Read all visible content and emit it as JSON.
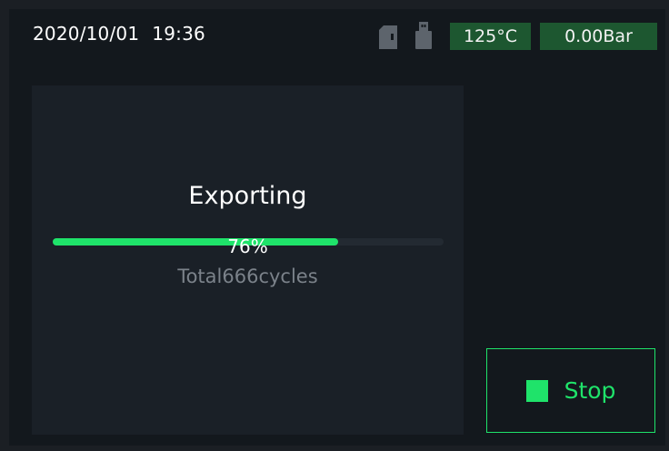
{
  "status_bar": {
    "date": "2020/10/01",
    "time": "19:36",
    "icons": [
      "sd-card-icon",
      "usb-drive-icon"
    ],
    "temperature": "125°C",
    "pressure": "0.00Bar"
  },
  "export": {
    "title": "Exporting",
    "progress_percent_label": "76%",
    "progress_fraction": 0.73,
    "cycles_text": "Total666cycles"
  },
  "actions": {
    "stop_label": "Stop"
  },
  "colors": {
    "background": "#13181d",
    "panel": "#1a2027",
    "accent": "#1fe36a",
    "badge": "#1d5730",
    "muted_text": "#7b828a"
  }
}
